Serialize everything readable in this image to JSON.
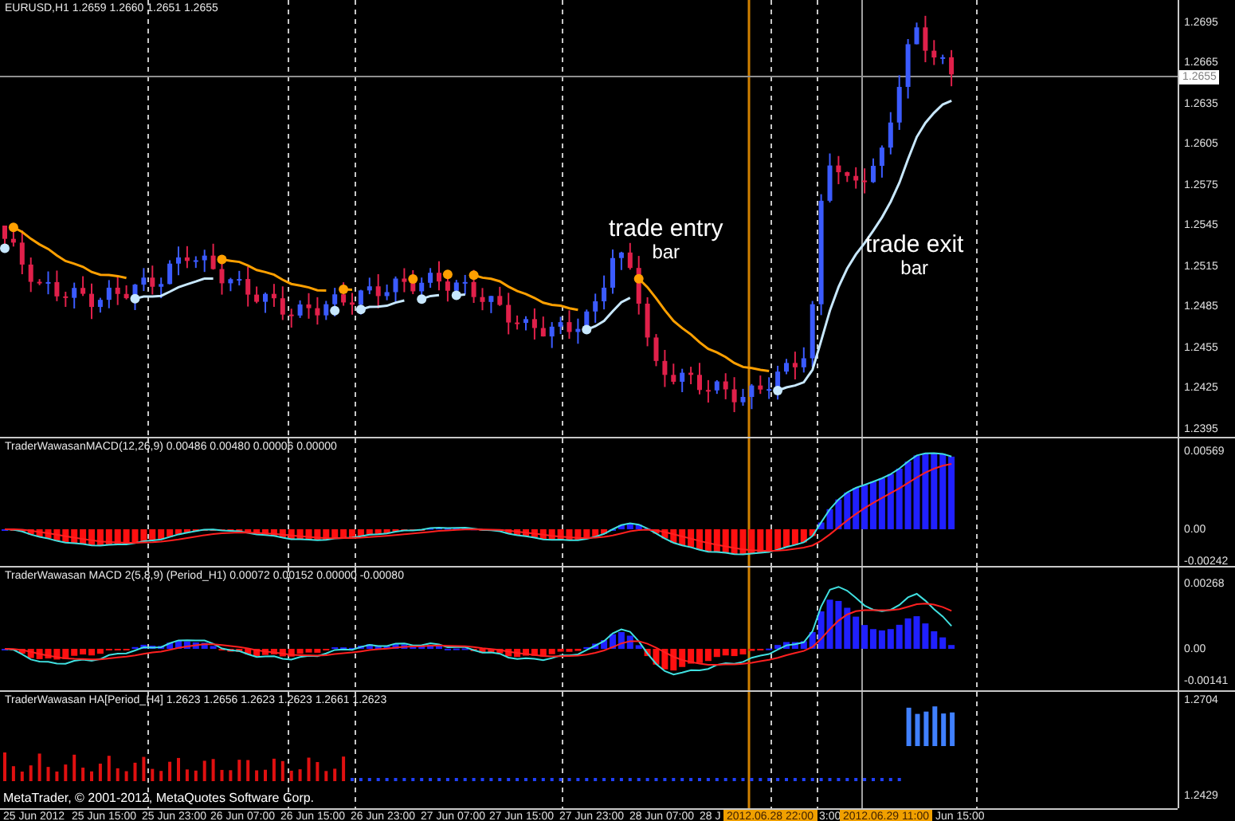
{
  "panels": [
    {
      "kind": "price",
      "label": "EURUSD,H1  1.2659 1.2660 1.2651 1.2655",
      "axis": [
        "1.2695",
        "1.2665",
        "1.2635",
        "1.2605",
        "1.2575",
        "1.2545",
        "1.2515",
        "1.2485",
        "1.2455",
        "1.2425",
        "1.2395"
      ],
      "current_price": "1.2655",
      "annotations": [
        {
          "line1": "trade entry",
          "line2": "bar"
        },
        {
          "line1": "trade exit",
          "line2": "bar"
        }
      ]
    },
    {
      "kind": "macd",
      "label": "TraderWawasanMACD(12,26,9) 0.00486 0.00480 0.00006 0.00000",
      "axis": [
        "0.00569",
        "0.00",
        "-0.00242"
      ]
    },
    {
      "kind": "macd2",
      "label": "TraderWawasan MACD 2(5,8,9) (Period_H1) 0.00072 0.00152 0.00000 -0.00080",
      "axis": [
        "0.00268",
        "0.00",
        "-0.00141"
      ]
    },
    {
      "kind": "ha",
      "label": "TraderWawasan HA[Period_H4] 1.2623 1.2656 1.2623 1.2623 1.2661 1.2623",
      "axis": [
        "1.2704",
        "1.2429"
      ],
      "copyright": "MetaTrader, © 2001-2012, MetaQuotes Software Corp."
    }
  ],
  "time_axis": [
    {
      "text": "25 Jun 2012",
      "kind": "tick"
    },
    {
      "text": "25 Jun 15:00",
      "kind": "tick"
    },
    {
      "text": "25 Jun 23:00",
      "kind": "tick"
    },
    {
      "text": "26 Jun 07:00",
      "kind": "tick"
    },
    {
      "text": "26 Jun 15:00",
      "kind": "tick"
    },
    {
      "text": "26 Jun 23:00",
      "kind": "tick"
    },
    {
      "text": "27 Jun 07:00",
      "kind": "tick"
    },
    {
      "text": "27 Jun 15:00",
      "kind": "tick"
    },
    {
      "text": "27 Jun 23:00",
      "kind": "tick"
    },
    {
      "text": "28 Jun 07:00",
      "kind": "tick"
    },
    {
      "text": "28 J",
      "kind": "tick"
    },
    {
      "text": "2012.06.28 22:00",
      "kind": "highlight"
    },
    {
      "text": "3:00",
      "kind": "tick"
    },
    {
      "text": "2012.06.29 11:00",
      "kind": "highlight"
    },
    {
      "text": "Jun 15:00",
      "kind": "tick"
    }
  ]
}
